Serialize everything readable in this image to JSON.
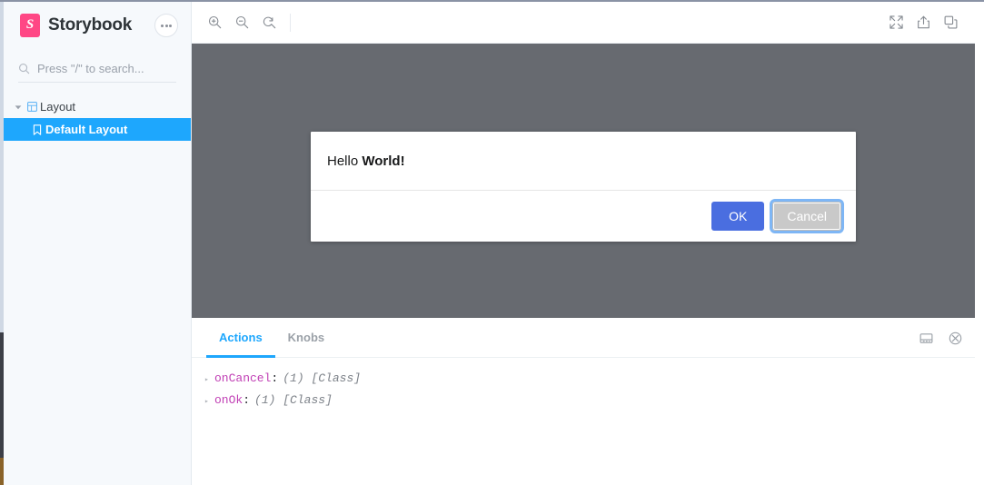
{
  "sidebar": {
    "brand": "Storybook",
    "logo_letter": "S",
    "logo_color": "#ff4785",
    "menu_button": "menu-dots",
    "search": {
      "placeholder": "Press \"/\" to search...",
      "value": ""
    },
    "tree": [
      {
        "label": "Layout",
        "type": "group",
        "expanded": true,
        "icon": "component-grid-icon"
      },
      {
        "label": "Default Layout",
        "type": "story",
        "selected": true,
        "icon": "bookmark-icon"
      }
    ],
    "selected_color": "#1ea7fd"
  },
  "toolbar": {
    "left": [
      {
        "name": "zoom-in-icon",
        "label": "Zoom in"
      },
      {
        "name": "zoom-out-icon",
        "label": "Zoom out"
      },
      {
        "name": "zoom-reset-icon",
        "label": "Reset zoom"
      }
    ],
    "right": [
      {
        "name": "fullscreen-icon",
        "label": "Go full screen"
      },
      {
        "name": "open-in-new-tab-icon",
        "label": "Open canvas in new tab"
      },
      {
        "name": "copy-link-icon",
        "label": "Copy canvas link"
      }
    ]
  },
  "canvas": {
    "background": "#676a70",
    "dialog": {
      "message_prefix": "Hello ",
      "message_bold": "World!",
      "ok_label": "OK",
      "cancel_label": "Cancel",
      "ok_color": "#4a6ee0",
      "cancel_color": "#c9c9c9",
      "cancel_focused": true
    }
  },
  "panel": {
    "tabs": [
      {
        "label": "Actions",
        "active": true
      },
      {
        "label": "Knobs",
        "active": false
      }
    ],
    "active_color": "#1ea7fd",
    "icons": [
      {
        "name": "panel-position-icon",
        "label": "Change addon orientation"
      },
      {
        "name": "clear-icon",
        "label": "Clear"
      }
    ],
    "logs": [
      {
        "caret": "▸",
        "key": "onCancel",
        "separator": ":",
        "value": "(1) [Class]"
      },
      {
        "caret": "▸",
        "key": "onOk",
        "separator": ":",
        "value": "(1) [Class]"
      }
    ],
    "key_color": "#c140b5",
    "value_color": "#7c8188"
  }
}
